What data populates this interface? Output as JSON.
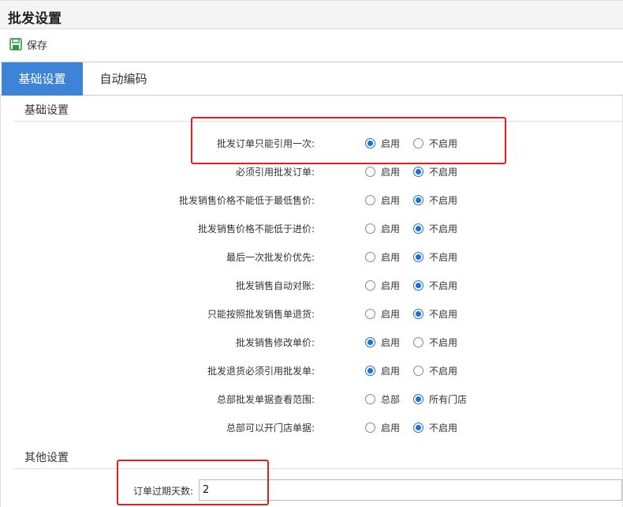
{
  "page": {
    "title": "批发设置"
  },
  "toolbar": {
    "save_label": "保存"
  },
  "tabs": [
    {
      "label": "基础设置",
      "active": true
    },
    {
      "label": "自动编码",
      "active": false
    }
  ],
  "basic_section": {
    "title": "基础设置"
  },
  "settings": [
    {
      "label": "批发订单只能引用一次:",
      "options": [
        "启用",
        "不启用"
      ],
      "selected": 0
    },
    {
      "label": "必须引用批发订单:",
      "options": [
        "启用",
        "不启用"
      ],
      "selected": 1
    },
    {
      "label": "批发销售价格不能低于最低售价:",
      "options": [
        "启用",
        "不启用"
      ],
      "selected": 1
    },
    {
      "label": "批发销售价格不能低于进价:",
      "options": [
        "启用",
        "不启用"
      ],
      "selected": 1
    },
    {
      "label": "最后一次批发价优先:",
      "options": [
        "启用",
        "不启用"
      ],
      "selected": 1
    },
    {
      "label": "批发销售自动对账:",
      "options": [
        "启用",
        "不启用"
      ],
      "selected": 1
    },
    {
      "label": "只能按照批发销售单退货:",
      "options": [
        "启用",
        "不启用"
      ],
      "selected": 1
    },
    {
      "label": "批发销售修改单价:",
      "options": [
        "启用",
        "不启用"
      ],
      "selected": 0
    },
    {
      "label": "批发退货必须引用批发单:",
      "options": [
        "启用",
        "不启用"
      ],
      "selected": 0
    },
    {
      "label": "总部批发单据查看范围:",
      "options": [
        "总部",
        "所有门店"
      ],
      "selected": 1
    },
    {
      "label": "总部可以开门店单据:",
      "options": [
        "启用",
        "不启用"
      ],
      "selected": 1
    }
  ],
  "other_section": {
    "title": "其他设置"
  },
  "order_expiry": {
    "label": "订单过期天数:",
    "value": "2"
  },
  "colors": {
    "accent": "#3d83d8",
    "radio": "#1b6fd6",
    "highlight": "#e02020"
  }
}
